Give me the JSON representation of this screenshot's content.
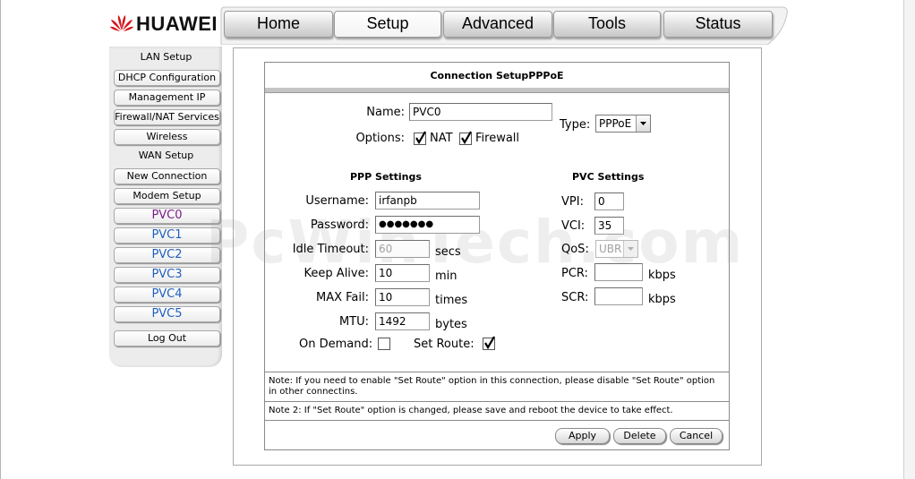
{
  "brand": {
    "name": "HUAWEI"
  },
  "tabs": [
    {
      "label": "Home"
    },
    {
      "label": "Setup"
    },
    {
      "label": "Advanced"
    },
    {
      "label": "Tools"
    },
    {
      "label": "Status"
    }
  ],
  "sidebar": {
    "lan_header": "LAN Setup",
    "dhcp": "DHCP Configuration",
    "mgmt_ip": "Management IP",
    "firewall_nat": "Firewall/NAT Services",
    "wireless": "Wireless",
    "wan_header": "WAN Setup",
    "new_connection": "New Connection",
    "modem_setup": "Modem Setup",
    "pvcs": [
      "PVC0",
      "PVC1",
      "PVC2",
      "PVC3",
      "PVC4",
      "PVC5"
    ],
    "logout": "Log Out"
  },
  "form": {
    "title": "Connection SetupPPPoE",
    "name_label": "Name:",
    "name_value": "PVC0",
    "options_label": "Options:",
    "nat_label": "NAT",
    "firewall_label": "Firewall",
    "type_label": "Type:",
    "type_value": "PPPoE",
    "ppp_settings": "PPP Settings",
    "pvc_settings": "PVC Settings",
    "username_label": "Username:",
    "username_value": "irfanpb",
    "password_label": "Password:",
    "password_value": "●●●●●●●",
    "idle_label": "Idle Timeout:",
    "idle_value": "60",
    "idle_unit": "secs",
    "keepalive_label": "Keep Alive:",
    "keepalive_value": "10",
    "keepalive_unit": "min",
    "maxfail_label": "MAX Fail:",
    "maxfail_value": "10",
    "maxfail_unit": "times",
    "mtu_label": "MTU:",
    "mtu_value": "1492",
    "mtu_unit": "bytes",
    "ondemand_label": "On Demand:",
    "setroute_label": "Set Route:",
    "vpi_label": "VPI:",
    "vpi_value": "0",
    "vci_label": "VCI:",
    "vci_value": "35",
    "qos_label": "QoS:",
    "qos_value": "UBR",
    "pcr_label": "PCR:",
    "pcr_unit": "kbps",
    "scr_label": "SCR:",
    "scr_unit": "kbps",
    "note1": "Note: If you need to enable \"Set Route\" option in this connection, please disable \"Set Route\" option in other connectins.",
    "note2": "Note 2: If \"Set Route\" option is changed, please save and reboot the device to take effect."
  },
  "buttons": {
    "apply": "Apply",
    "delete": "Delete",
    "cancel": "Cancel"
  },
  "watermark": "PcWinTech.com"
}
